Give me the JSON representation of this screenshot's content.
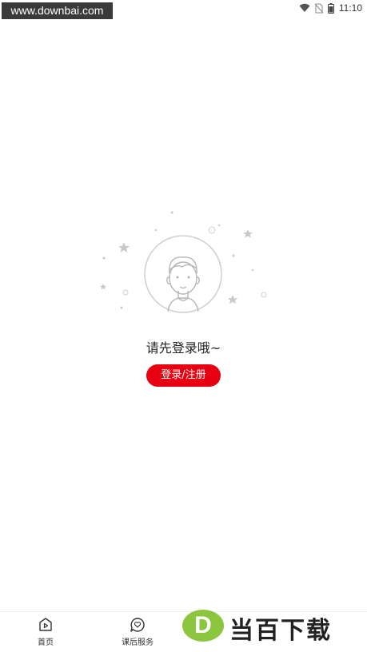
{
  "watermark_top": "www.downbai.com",
  "status": {
    "time": "11:10",
    "icons": [
      "wifi-icon",
      "no-sim-icon",
      "battery-icon"
    ]
  },
  "empty_state": {
    "message": "请先登录哦~",
    "button_label": "登录/注册",
    "illustration": "avatar-placeholder"
  },
  "tabbar": {
    "tabs": [
      {
        "label": "首页",
        "icon": "play-home-icon"
      },
      {
        "label": "课后服务",
        "icon": "heart-chat-icon"
      }
    ]
  },
  "watermark_bottom": {
    "logo_letter": "D",
    "text": "当百下载"
  },
  "colors": {
    "accent": "#e60012",
    "watermark_green": "#8cc63f"
  }
}
